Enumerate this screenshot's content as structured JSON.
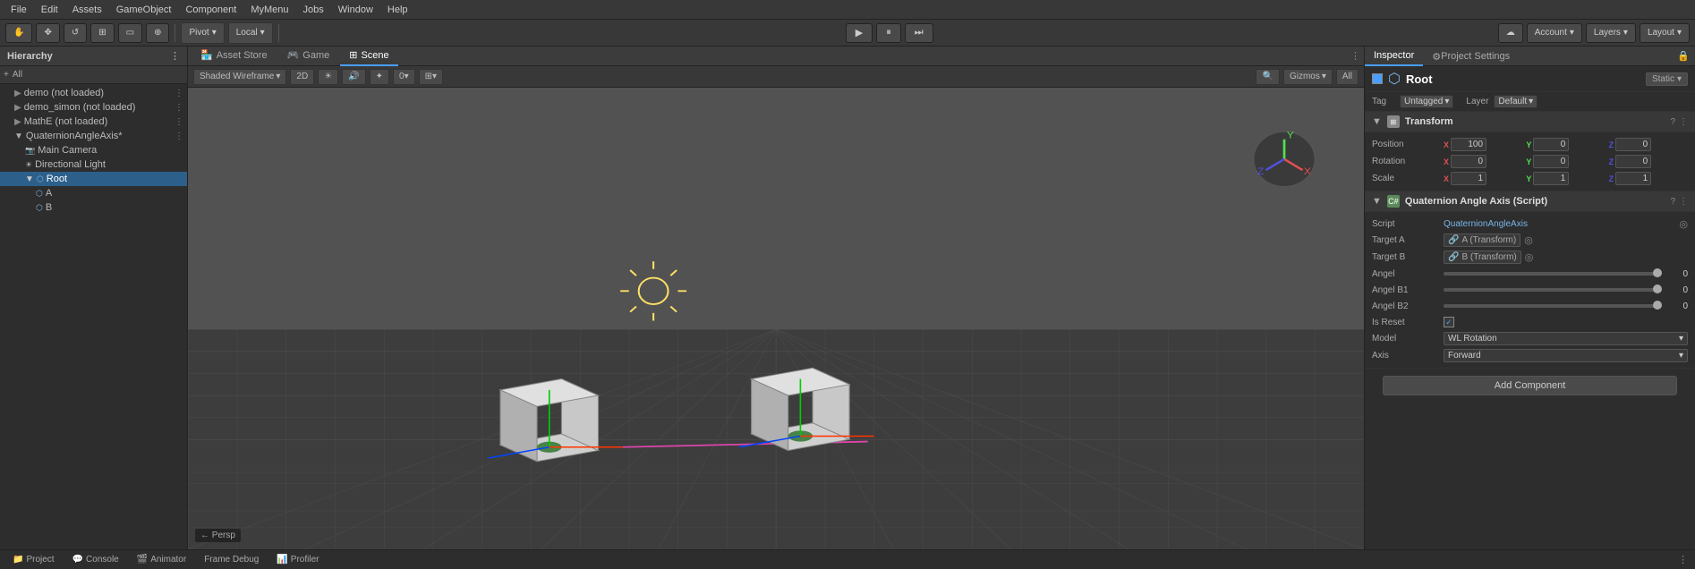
{
  "menubar": {
    "items": [
      "File",
      "Edit",
      "Assets",
      "GameObject",
      "Component",
      "MyMenu",
      "Jobs",
      "Window",
      "Help"
    ]
  },
  "toolbar": {
    "pivot_label": "Pivot",
    "local_label": "Local",
    "play_btn": "▶",
    "pause_btn": "⏸",
    "step_btn": "⏭",
    "account_label": "Account",
    "layers_label": "Layers",
    "layout_label": "Layout"
  },
  "hierarchy": {
    "title": "Hierarchy",
    "all_label": "All",
    "items": [
      {
        "label": "demo (not loaded)",
        "indent": 1,
        "icon": "scene"
      },
      {
        "label": "demo_simon (not loaded)",
        "indent": 1,
        "icon": "scene"
      },
      {
        "label": "MathE (not loaded)",
        "indent": 1,
        "icon": "scene"
      },
      {
        "label": "QuaternionAngleAxis*",
        "indent": 1,
        "icon": "scene",
        "expanded": true
      },
      {
        "label": "Main Camera",
        "indent": 2,
        "icon": "camera"
      },
      {
        "label": "Directional Light",
        "indent": 2,
        "icon": "light"
      },
      {
        "label": "Root",
        "indent": 2,
        "icon": "object",
        "selected": true
      },
      {
        "label": "A",
        "indent": 3,
        "icon": "object"
      },
      {
        "label": "B",
        "indent": 3,
        "icon": "object"
      }
    ]
  },
  "scene": {
    "tabs": [
      "Asset Store",
      "Game",
      "Scene"
    ],
    "active_tab": "Scene",
    "toolbar": {
      "shading_mode": "Shaded Wireframe",
      "view_2d": "2D",
      "gizmos_label": "Gizmos",
      "all_label": "All"
    },
    "persp_label": "← Persp"
  },
  "inspector": {
    "tabs": [
      "Inspector",
      "Project Settings"
    ],
    "active_tab": "Inspector",
    "obj_name": "Root",
    "static_label": "Static",
    "tag_label": "Tag",
    "tag_value": "Untagged",
    "layer_label": "Layer",
    "layer_value": "Default",
    "components": {
      "transform": {
        "title": "Transform",
        "position": {
          "label": "Position",
          "x": "100",
          "y": "0",
          "z": "0"
        },
        "rotation": {
          "label": "Rotation",
          "x": "0",
          "y": "0",
          "z": "0"
        },
        "scale": {
          "label": "Scale",
          "x": "1",
          "y": "1",
          "z": "1"
        }
      },
      "script": {
        "title": "Quaternion Angle Axis (Script)",
        "script_label": "Script",
        "script_value": "QuaternionAngleAxis",
        "target_a_label": "Target A",
        "target_a_value": "A (Transform)",
        "target_b_label": "Target B",
        "target_b_value": "B (Transform)",
        "angel_label": "Angel",
        "angel_value": "0",
        "angel_b1_label": "Angel B1",
        "angel_b1_value": "0",
        "angel_b2_label": "Angel B2",
        "angel_b2_value": "0",
        "is_reset_label": "Is Reset",
        "model_label": "Model",
        "model_value": "WL Rotation",
        "axis_label": "Axis",
        "axis_value": "Forward"
      }
    },
    "add_component_label": "Add Component"
  },
  "bottombar": {
    "tabs": [
      "Project",
      "Console",
      "Animator",
      "Frame Debug",
      "Profiler"
    ]
  },
  "colors": {
    "selected_blue": "#2c5f8a",
    "accent_blue": "#4a9eff",
    "bg_dark": "#2d2d2d",
    "bg_medium": "#383838",
    "bg_light": "#4a4a4a"
  }
}
